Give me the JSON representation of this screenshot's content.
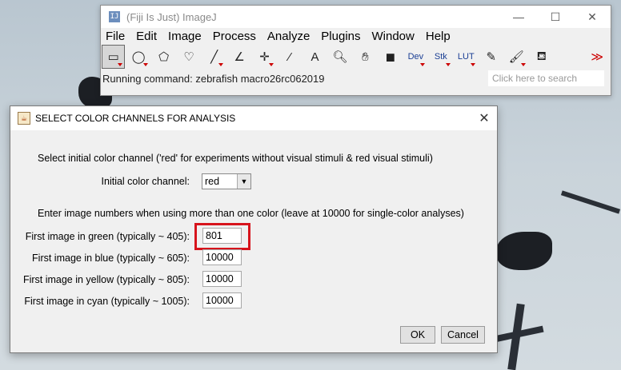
{
  "imagej": {
    "title": "(Fiji Is Just) ImageJ",
    "app_icon_text": "IJ",
    "window_buttons": {
      "minimize": "—",
      "maximize": "☐",
      "close": "✕"
    },
    "menu": [
      "File",
      "Edit",
      "Image",
      "Process",
      "Analyze",
      "Plugins",
      "Window",
      "Help"
    ],
    "tools": [
      {
        "name": "rectangle-tool-icon",
        "glyph": "▭",
        "selected": true
      },
      {
        "name": "oval-tool-icon",
        "glyph": "◯"
      },
      {
        "name": "polygon-tool-icon",
        "glyph": "⬠"
      },
      {
        "name": "freehand-tool-icon",
        "glyph": "♡"
      },
      {
        "name": "line-tool-icon",
        "glyph": "╱"
      },
      {
        "name": "angle-tool-icon",
        "glyph": "∠"
      },
      {
        "name": "point-tool-icon",
        "glyph": "✛"
      },
      {
        "name": "wand-tool-icon",
        "glyph": "⁄"
      },
      {
        "name": "text-tool-icon",
        "glyph": "A"
      },
      {
        "name": "zoom-tool-icon",
        "glyph": "🔍︎"
      },
      {
        "name": "hand-tool-icon",
        "glyph": "✋︎"
      },
      {
        "name": "color-picker-icon",
        "glyph": "◼"
      },
      {
        "name": "dev-tool-icon",
        "glyph": "Dev"
      },
      {
        "name": "stk-tool-icon",
        "glyph": "Stk"
      },
      {
        "name": "lut-tool-icon",
        "glyph": "LUT"
      },
      {
        "name": "pencil-tool-icon",
        "glyph": "✎"
      },
      {
        "name": "brush-tool-icon",
        "glyph": "🖌︎"
      },
      {
        "name": "flood-fill-tool-icon",
        "glyph": "⛾"
      },
      {
        "name": "empty-tool-slot",
        "glyph": ""
      },
      {
        "name": "more-tools-icon",
        "glyph": "≫"
      }
    ],
    "status": "Running command: zebrafish macro26rc062019",
    "search_placeholder": "Click here to search"
  },
  "dialog": {
    "title": "SELECT COLOR CHANNELS FOR ANALYSIS",
    "intro": "Select initial color channel ('red' for experiments without visual stimuli & red visual stimuli)",
    "channel_label": "Initial color channel:",
    "channel_value": "red",
    "instructions": "Enter image numbers when using more than one color (leave at 10000 for single-color analyses)",
    "fields": [
      {
        "label": "First image in green (typically ~ 405):",
        "value": "801"
      },
      {
        "label": "First image in blue (typically ~ 605):",
        "value": "10000"
      },
      {
        "label": "First image in yellow (typically ~ 805):",
        "value": "10000"
      },
      {
        "label": "First image in cyan (typically ~ 1005):",
        "value": "10000"
      }
    ],
    "ok_label": "OK",
    "cancel_label": "Cancel",
    "highlight_color": "#d7141c"
  }
}
